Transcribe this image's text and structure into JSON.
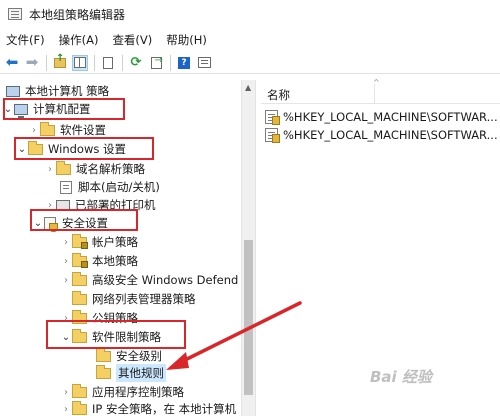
{
  "window": {
    "title": "本地组策略编辑器"
  },
  "menu": [
    {
      "label": "文件(F)"
    },
    {
      "label": "操作(A)"
    },
    {
      "label": "查看(V)"
    },
    {
      "label": "帮助(H)"
    }
  ],
  "toolbar": {
    "buttons": [
      "back-icon",
      "forward-icon",
      "up-folder-icon",
      "show-tree-icon",
      "properties-icon",
      "refresh-icon",
      "export-list-icon",
      "help-icon",
      "extended-view-icon"
    ]
  },
  "tree": {
    "root": "本地计算机 策略",
    "computer_config": "计算机配置",
    "software_settings": "软件设置",
    "windows_settings": "Windows 设置",
    "dns_policy": "域名解析策略",
    "scripts": "脚本(启动/关机)",
    "deployed_printers": "已部署的打印机",
    "security_settings": "安全设置",
    "account_policies": "帐户策略",
    "local_policies": "本地策略",
    "firewall": "高级安全 Windows Defend",
    "network_list": "网络列表管理器策略",
    "public_key": "公钥策略",
    "software_restriction": "软件限制策略",
    "security_levels": "安全级别",
    "additional_rules": "其他规则",
    "applocker": "应用程序控制策略",
    "ip_security": "IP 安全策略，在 本地计算机"
  },
  "list": {
    "column_name": "名称",
    "items": [
      "%HKEY_LOCAL_MACHINE\\SOFTWAR...",
      "%HKEY_LOCAL_MACHINE\\SOFTWAR..."
    ]
  },
  "watermark": "Bai 经验",
  "colors": {
    "highlight_box": "#d9262b",
    "selection": "#cce8ff",
    "folder": "#f4cf64"
  }
}
